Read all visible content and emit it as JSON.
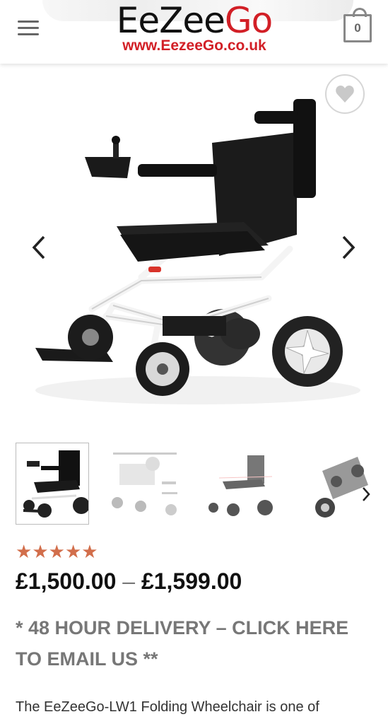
{
  "header": {
    "logo_main": "EeZee",
    "logo_accent": "Go",
    "logo_url": "www.EezeeGo.co.uk",
    "cart_count": "0",
    "menu_icon": "hamburger-menu-icon",
    "cart_icon": "cart-icon"
  },
  "gallery": {
    "wishlist_icon": "heart-icon",
    "prev_icon": "chevron-left-icon",
    "next_icon": "chevron-right-icon",
    "thumbnail_count": 4,
    "active_thumbnail": 1
  },
  "product": {
    "rating": 5,
    "rating_max": 5,
    "price_low": "£1,500.00",
    "price_sep": "–",
    "price_high": "£1,599.00",
    "delivery_text": "* 48 HOUR DELIVERY – CLICK HERE TO EMAIL US **",
    "description": "The EeZeeGo-LW1 Folding Wheelchair is one of"
  },
  "colors": {
    "brand_red": "#d21f26",
    "star": "#d26e4b",
    "muted_text": "#777777"
  }
}
